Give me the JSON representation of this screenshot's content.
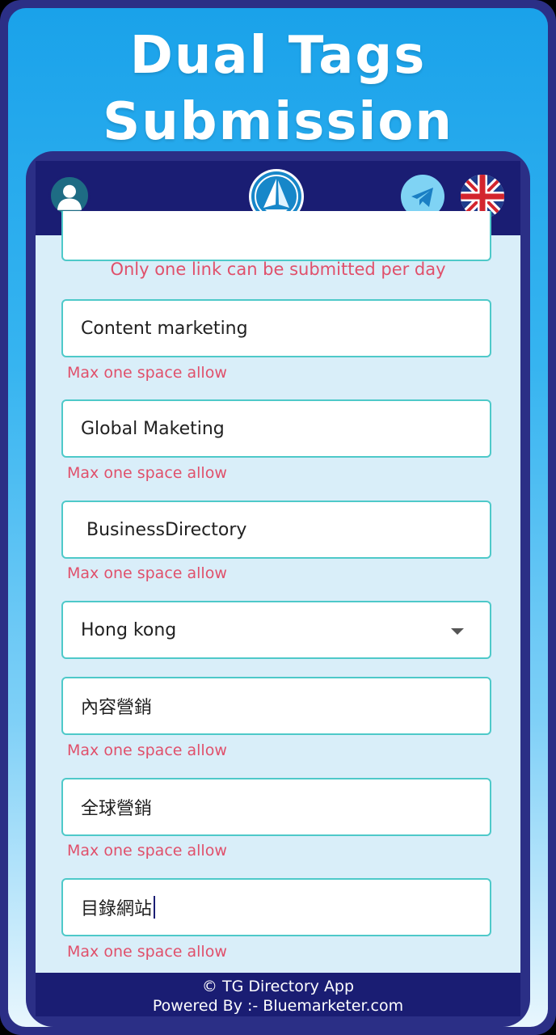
{
  "poster": {
    "headline_line1": "Dual Tags",
    "headline_line2": "Submission"
  },
  "topbar": {
    "avatar_icon": "user-avatar-icon",
    "logo_icon": "sailboat-logo-icon",
    "telegram_icon": "telegram-icon",
    "language_icon": "uk-flag-icon"
  },
  "form": {
    "link_notice": "Only one link can be submitted per day",
    "tag_en_1": {
      "value": "Content marketing",
      "hint": "Max one space allow"
    },
    "tag_en_2": {
      "value": "Global Maketing",
      "hint": "Max one space allow"
    },
    "tag_en_3": {
      "value": " BusinessDirectory",
      "hint": "Max one space allow"
    },
    "region": {
      "selected": "Hong kong"
    },
    "tag_zh_1": {
      "value": "內容營銷",
      "hint": "Max one space allow"
    },
    "tag_zh_2": {
      "value": "全球營銷",
      "hint": "Max one space allow"
    },
    "tag_zh_3": {
      "value": "目錄網站",
      "hint": "Max one space allow"
    }
  },
  "footer": {
    "line1": "© TG Directory App",
    "line2": "Powered By :- Bluemarketer.com"
  },
  "colors": {
    "navy": "#1a1d73",
    "frame": "#2b2f86",
    "field_border": "#4ec9c9",
    "error_text": "#e0506b",
    "screen_bg": "#d9eef9"
  }
}
